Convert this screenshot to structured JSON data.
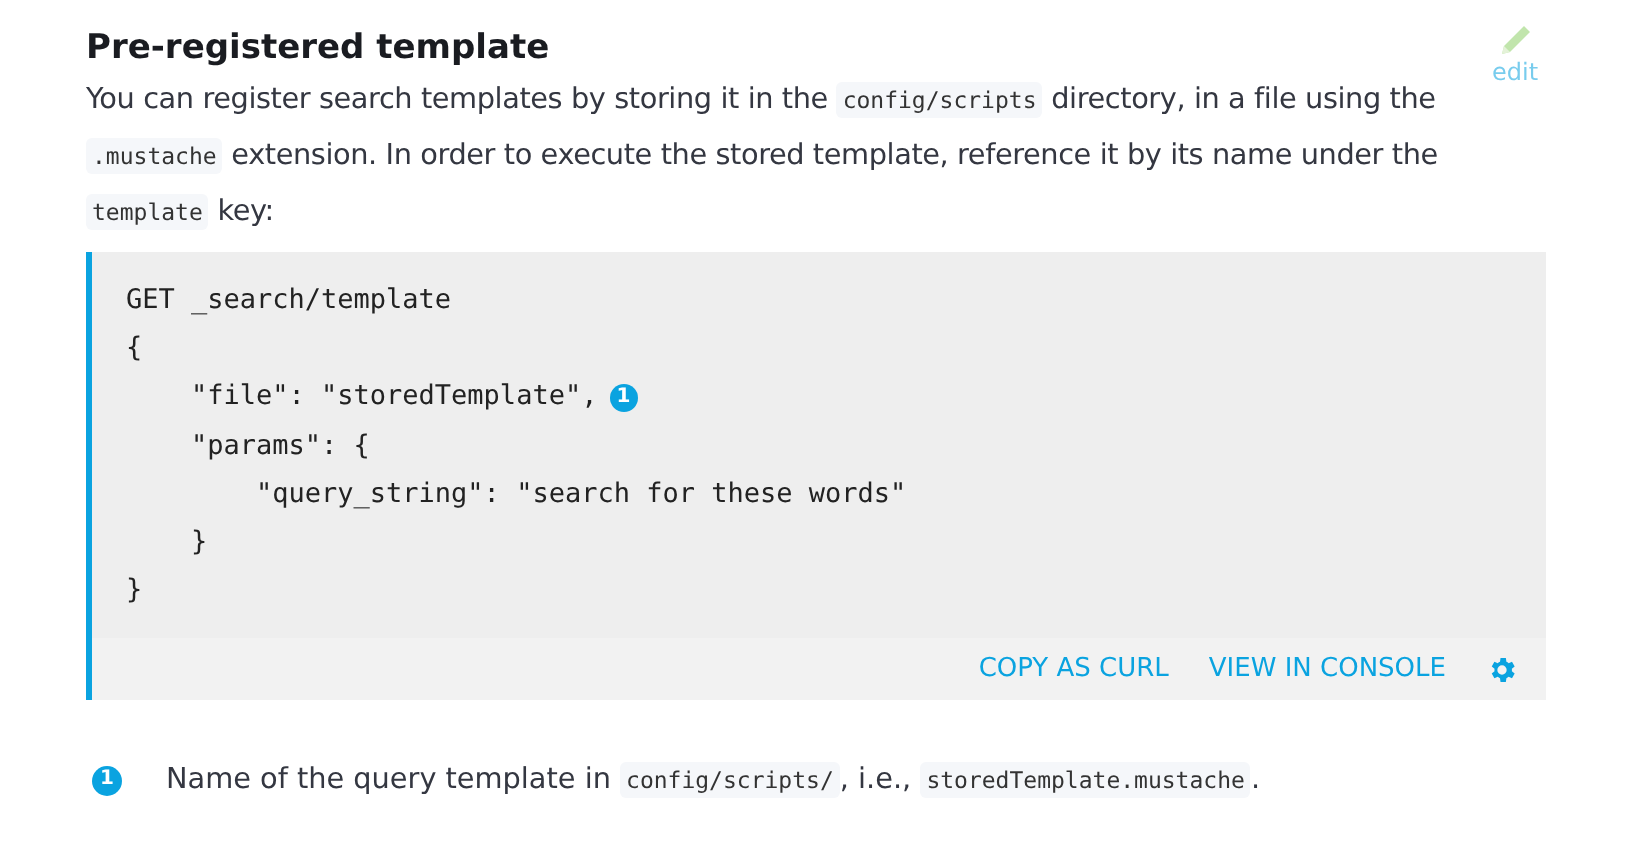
{
  "heading": "Pre-registered template",
  "edit_link": "edit",
  "paragraph": [
    {
      "kind": "text",
      "text": "You can register search templates by storing it in the "
    },
    {
      "kind": "code",
      "text": "config/scripts"
    },
    {
      "kind": "text",
      "text": " directory, in a file using the "
    },
    {
      "kind": "code",
      "text": ".mustache"
    },
    {
      "kind": "text",
      "text": " extension. In order to execute the stored template, reference it by its name under the "
    },
    {
      "kind": "code",
      "text": "template"
    },
    {
      "kind": "text",
      "text": " key:"
    }
  ],
  "code_block": {
    "lines": [
      {
        "text": "GET _search/template"
      },
      {
        "text": "{"
      },
      {
        "text": "    \"file\": \"storedTemplate\",",
        "callout": "1"
      },
      {
        "text": "    \"params\": {"
      },
      {
        "text": "        \"query_string\": \"search for these words\""
      },
      {
        "text": "    }"
      },
      {
        "text": "}"
      }
    ],
    "actions": [
      "COPY AS CURL",
      "VIEW IN CONSOLE"
    ]
  },
  "callouts": [
    {
      "number": "1",
      "segments": [
        {
          "kind": "text",
          "text": "Name of the query template in "
        },
        {
          "kind": "code",
          "text": "config/scripts/"
        },
        {
          "kind": "text",
          "text": ", i.e., "
        },
        {
          "kind": "code",
          "text": "storedTemplate.mustache"
        },
        {
          "kind": "text",
          "text": "."
        }
      ]
    }
  ]
}
